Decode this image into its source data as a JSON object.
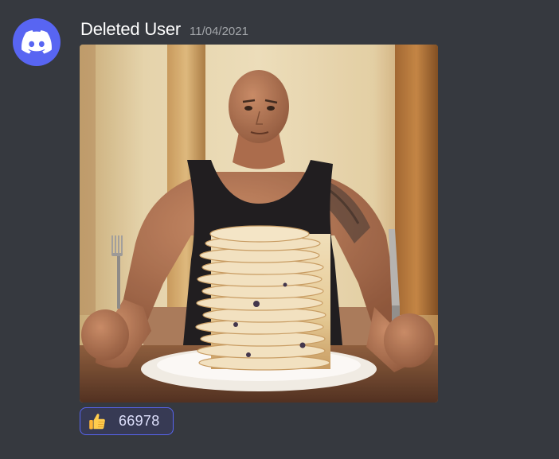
{
  "message": {
    "author": "Deleted User",
    "timestamp": "11/04/2021",
    "avatar_icon": "discord-logo-icon",
    "avatar_color": "#5865f2"
  },
  "attachment": {
    "type": "image",
    "subject": "muscular man in black tank top seated at a table with a tall stack of pancakes, holding a fork and a knife"
  },
  "reactions": [
    {
      "emoji": "thumbs-up-icon",
      "count": "66978",
      "active": true
    }
  ],
  "colors": {
    "background": "#36393f",
    "username": "#ffffff",
    "timestamp": "#a3a6aa",
    "reaction_border": "#5865f2",
    "reaction_bg": "#373a54"
  }
}
